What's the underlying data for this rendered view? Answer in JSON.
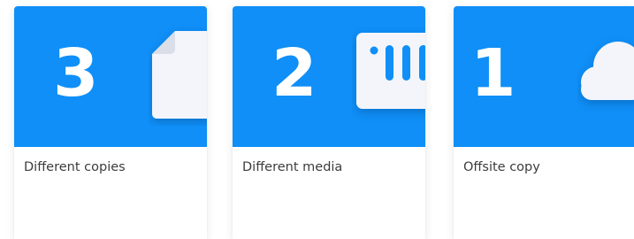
{
  "cards": [
    {
      "number": "3",
      "label": "Different copies",
      "icon": "document-icon"
    },
    {
      "number": "2",
      "label": "Different media",
      "icon": "storage-device-icon"
    },
    {
      "number": "1",
      "label": "Offsite copy",
      "icon": "cloud-icon"
    }
  ],
  "colors": {
    "hero_blue": "#0f8ff7",
    "icon_fill": "#f3f5fa",
    "text": "#3c3c3c"
  }
}
